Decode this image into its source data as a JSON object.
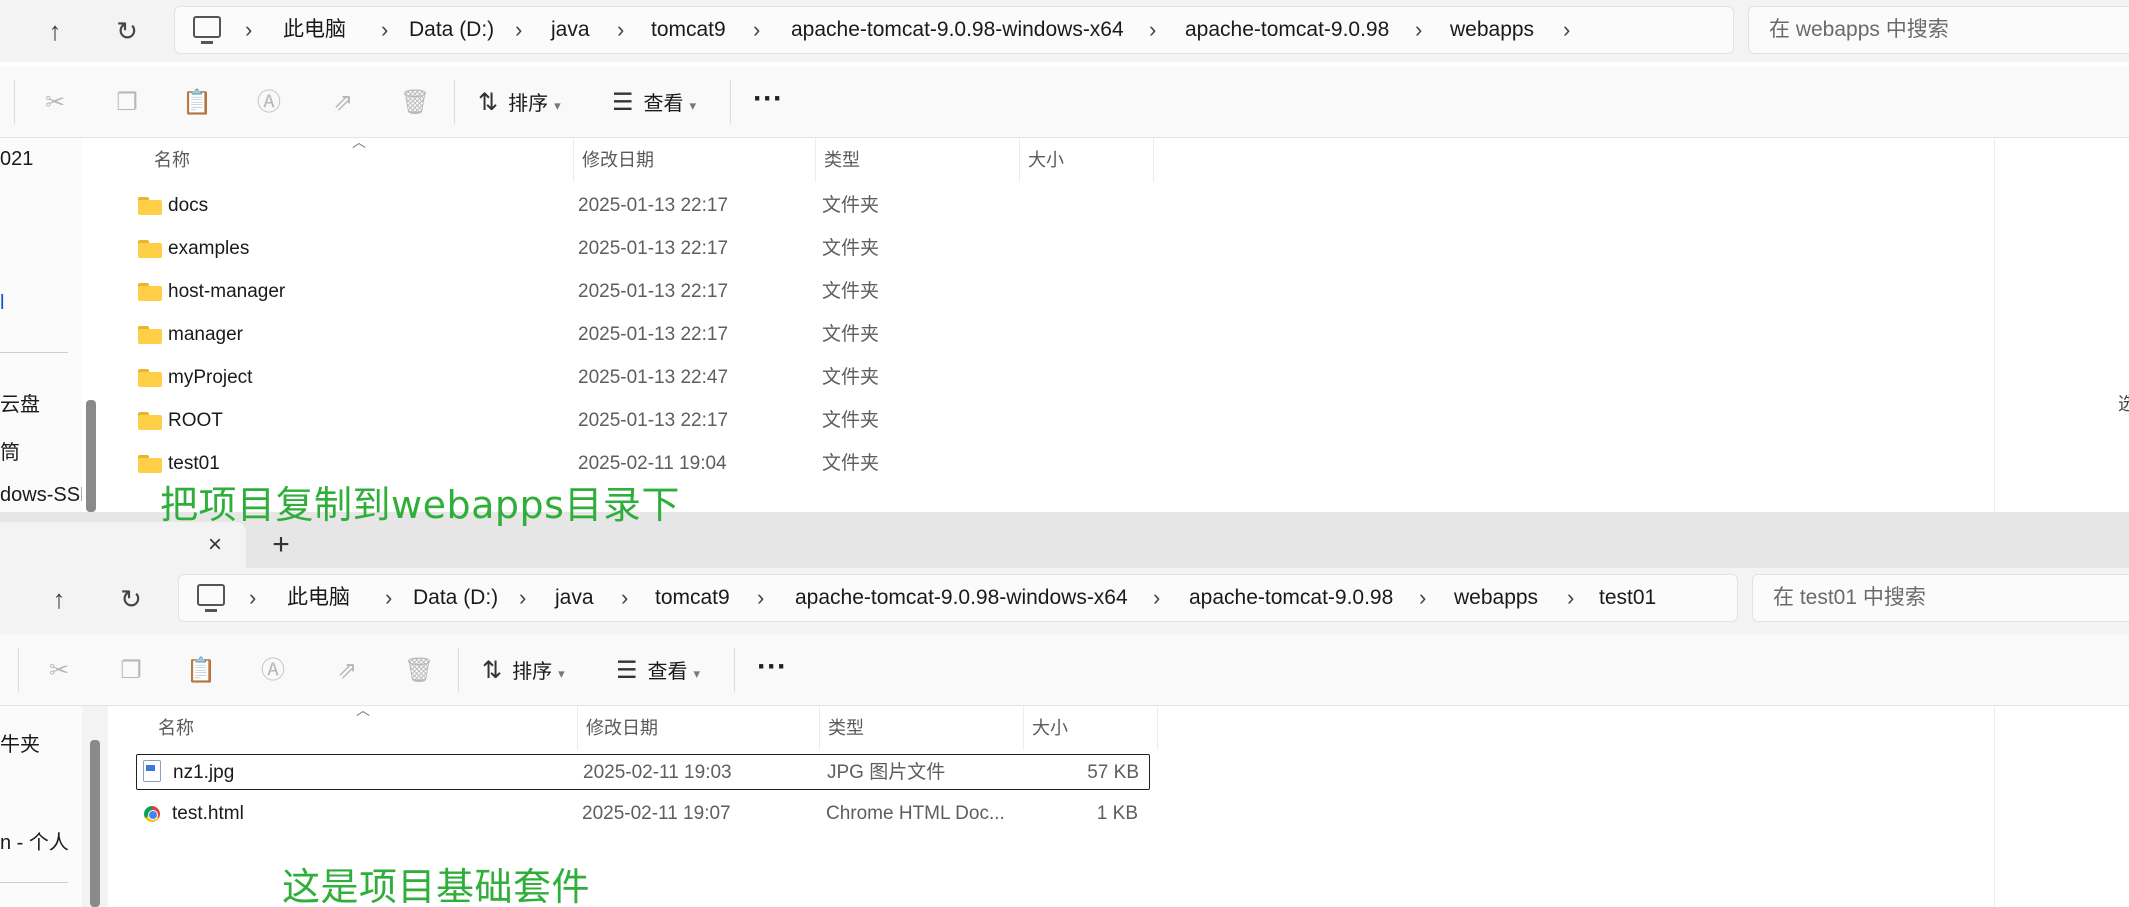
{
  "top_window": {
    "breadcrumb": [
      "此电脑",
      "Data (D:)",
      "java",
      "tomcat9",
      "apache-tomcat-9.0.98-windows-x64",
      "apache-tomcat-9.0.98",
      "webapps"
    ],
    "search_placeholder": "在 webapps 中搜索",
    "toolbar": {
      "sort_label": "排序",
      "view_label": "查看",
      "more_label": "···"
    },
    "nav_pane": [
      "021",
      "l",
      "云盘",
      "筒",
      "dows-SSD"
    ],
    "columns": {
      "name": "名称",
      "date": "修改日期",
      "type": "类型",
      "size": "大小"
    },
    "files": [
      {
        "name": "docs",
        "date": "2025-01-13 22:17",
        "type": "文件夹",
        "size": ""
      },
      {
        "name": "examples",
        "date": "2025-01-13 22:17",
        "type": "文件夹",
        "size": ""
      },
      {
        "name": "host-manager",
        "date": "2025-01-13 22:17",
        "type": "文件夹",
        "size": ""
      },
      {
        "name": "manager",
        "date": "2025-01-13 22:17",
        "type": "文件夹",
        "size": ""
      },
      {
        "name": "myProject",
        "date": "2025-01-13 22:47",
        "type": "文件夹",
        "size": ""
      },
      {
        "name": "ROOT",
        "date": "2025-01-13 22:17",
        "type": "文件夹",
        "size": ""
      },
      {
        "name": "test01",
        "date": "2025-02-11 19:04",
        "type": "文件夹",
        "size": ""
      }
    ],
    "edge_char": "选",
    "annotation": "把项目复制到webapps目录下"
  },
  "bottom_window": {
    "tab_close": "×",
    "tab_add": "+",
    "breadcrumb": [
      "此电脑",
      "Data (D:)",
      "java",
      "tomcat9",
      "apache-tomcat-9.0.98-windows-x64",
      "apache-tomcat-9.0.98",
      "webapps",
      "test01"
    ],
    "search_placeholder": "在 test01 中搜索",
    "toolbar": {
      "sort_label": "排序",
      "view_label": "查看",
      "more_label": "···"
    },
    "nav_pane": [
      "牛夹",
      "n - 个人"
    ],
    "columns": {
      "name": "名称",
      "date": "修改日期",
      "type": "类型",
      "size": "大小"
    },
    "files": [
      {
        "name": "nz1.jpg",
        "date": "2025-02-11 19:03",
        "type": "JPG 图片文件",
        "size": "57 KB",
        "icon": "image-file-icon",
        "selected": true
      },
      {
        "name": "test.html",
        "date": "2025-02-11 19:07",
        "type": "Chrome HTML Doc...",
        "size": "1 KB",
        "icon": "chrome-html-icon",
        "selected": false
      }
    ],
    "annotation": "这是项目基础套件"
  },
  "colors": {
    "annotation": "#2fae3a",
    "folder": "#ffcf48",
    "selection_border": "#222222"
  }
}
